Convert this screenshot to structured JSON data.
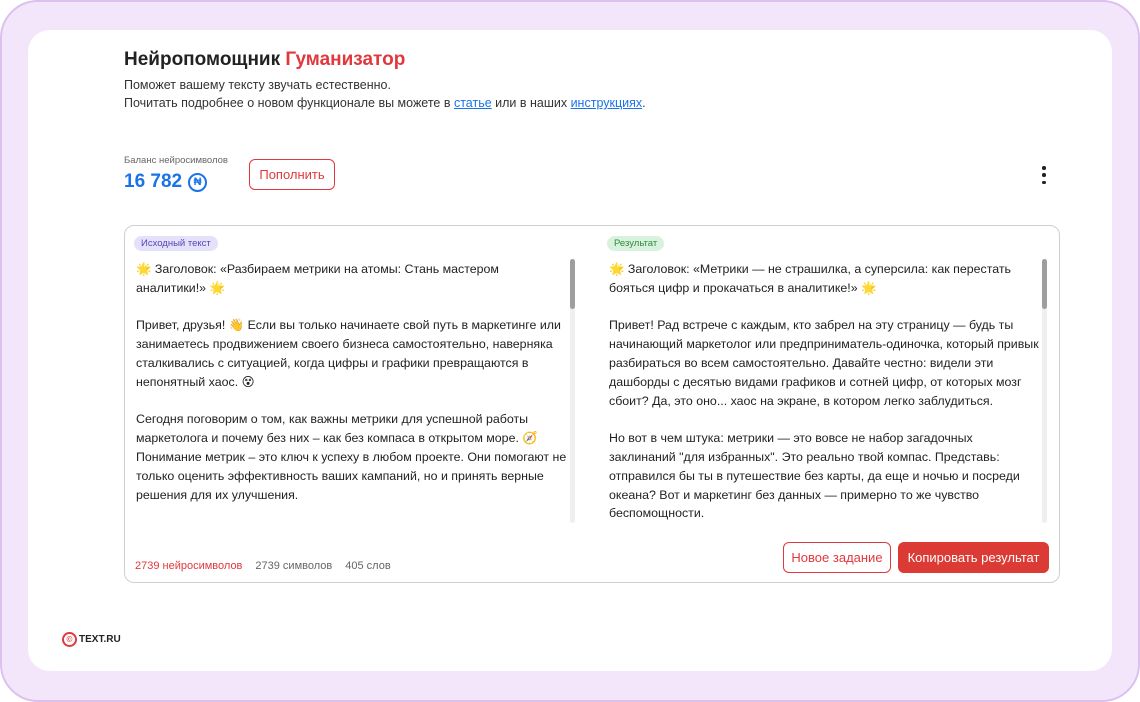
{
  "header": {
    "title_main": "Нейропомощник ",
    "title_accent": "Гуманизатор",
    "subtitle_line1": "Поможет вашему тексту звучать естественно.",
    "subtitle_line2_prefix": "Почитать подробнее о новом функционале вы можете в ",
    "link_article": "статье",
    "subtitle_line2_middle": " или в наших ",
    "link_instructions": "инструкциях",
    "subtitle_line2_suffix": "."
  },
  "balance": {
    "label": "Баланс нейросимволов",
    "value": "16 782",
    "currency_symbol": "₦",
    "topup_label": "Пополнить"
  },
  "menu": {
    "icon": "kebab-menu-icon"
  },
  "source": {
    "badge": "Исходный текст",
    "text": "🌟 Заголовок: «Разбираем метрики на атомы: Стань мастером аналитики!» 🌟\n\nПривет, друзья! 👋 Если вы только начинаете свой путь в маркетинге или занимаетесь продвижением своего бизнеса самостоятельно, наверняка сталкивались с ситуацией, когда цифры и графики превращаются в непонятный хаос. 😵\n\nСегодня поговорим о том, как важны метрики для успешной работы маркетолога и почему без них – как без компаса в открытом море. 🧭 Понимание метрик – это ключ к успеху в любом проекте. Они помогают не только оценить эффективность ваших кампаний, но и принять верные решения для их улучшения."
  },
  "result": {
    "badge": "Результат",
    "text": "🌟 Заголовок: «Метрики — не страшилка, а суперсила: как перестать бояться цифр и прокачаться в аналитике!» 🌟\n\nПривет! Рад встрече с каждым, кто забрел на эту страницу — будь ты начинающий маркетолог или предприниматель-одиночка, который привык разбираться во всем самостоятельно. Давайте честно: видели эти дашборды с десятью видами графиков и сотней цифр, от которых мозг сбоит? Да, это оно... хаос на экране, в котором легко заблудиться.\n\nНо вот в чем штука: метрики — это вовсе не набор загадочных заклинаний \"для избранных\". Это реально твой компас. Представь: отправился бы ты в путешествие без карты, да еще и ночью и посреди океана? Вот и маркетинг без данных — примерно то же чувство беспомощности."
  },
  "stats": {
    "neurosymbols": "2739 нейросимволов",
    "symbols": "2739 символов",
    "words": "405 слов"
  },
  "actions": {
    "new_task": "Новое задание",
    "copy_result": "Копировать результат"
  },
  "footer": {
    "logo_text": "TEXT.RU",
    "logo_mark": "©"
  },
  "colors": {
    "accent_red": "#e0383e",
    "link_blue": "#1a73e8",
    "frame_lilac": "#f3e6fa"
  }
}
